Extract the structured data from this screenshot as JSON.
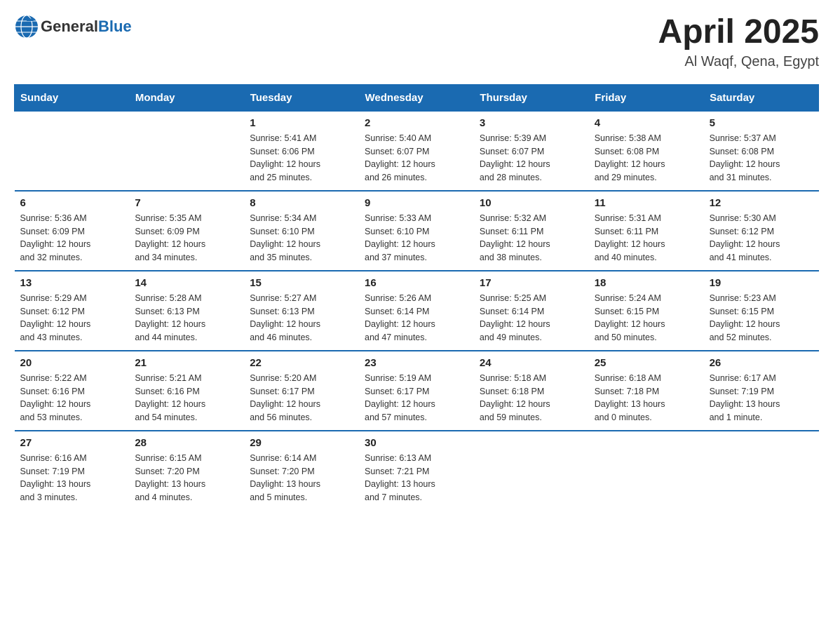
{
  "header": {
    "logo_general": "General",
    "logo_blue": "Blue",
    "month_year": "April 2025",
    "location": "Al Waqf, Qena, Egypt"
  },
  "weekdays": [
    "Sunday",
    "Monday",
    "Tuesday",
    "Wednesday",
    "Thursday",
    "Friday",
    "Saturday"
  ],
  "weeks": [
    [
      {
        "day": "",
        "info": ""
      },
      {
        "day": "",
        "info": ""
      },
      {
        "day": "1",
        "info": "Sunrise: 5:41 AM\nSunset: 6:06 PM\nDaylight: 12 hours\nand 25 minutes."
      },
      {
        "day": "2",
        "info": "Sunrise: 5:40 AM\nSunset: 6:07 PM\nDaylight: 12 hours\nand 26 minutes."
      },
      {
        "day": "3",
        "info": "Sunrise: 5:39 AM\nSunset: 6:07 PM\nDaylight: 12 hours\nand 28 minutes."
      },
      {
        "day": "4",
        "info": "Sunrise: 5:38 AM\nSunset: 6:08 PM\nDaylight: 12 hours\nand 29 minutes."
      },
      {
        "day": "5",
        "info": "Sunrise: 5:37 AM\nSunset: 6:08 PM\nDaylight: 12 hours\nand 31 minutes."
      }
    ],
    [
      {
        "day": "6",
        "info": "Sunrise: 5:36 AM\nSunset: 6:09 PM\nDaylight: 12 hours\nand 32 minutes."
      },
      {
        "day": "7",
        "info": "Sunrise: 5:35 AM\nSunset: 6:09 PM\nDaylight: 12 hours\nand 34 minutes."
      },
      {
        "day": "8",
        "info": "Sunrise: 5:34 AM\nSunset: 6:10 PM\nDaylight: 12 hours\nand 35 minutes."
      },
      {
        "day": "9",
        "info": "Sunrise: 5:33 AM\nSunset: 6:10 PM\nDaylight: 12 hours\nand 37 minutes."
      },
      {
        "day": "10",
        "info": "Sunrise: 5:32 AM\nSunset: 6:11 PM\nDaylight: 12 hours\nand 38 minutes."
      },
      {
        "day": "11",
        "info": "Sunrise: 5:31 AM\nSunset: 6:11 PM\nDaylight: 12 hours\nand 40 minutes."
      },
      {
        "day": "12",
        "info": "Sunrise: 5:30 AM\nSunset: 6:12 PM\nDaylight: 12 hours\nand 41 minutes."
      }
    ],
    [
      {
        "day": "13",
        "info": "Sunrise: 5:29 AM\nSunset: 6:12 PM\nDaylight: 12 hours\nand 43 minutes."
      },
      {
        "day": "14",
        "info": "Sunrise: 5:28 AM\nSunset: 6:13 PM\nDaylight: 12 hours\nand 44 minutes."
      },
      {
        "day": "15",
        "info": "Sunrise: 5:27 AM\nSunset: 6:13 PM\nDaylight: 12 hours\nand 46 minutes."
      },
      {
        "day": "16",
        "info": "Sunrise: 5:26 AM\nSunset: 6:14 PM\nDaylight: 12 hours\nand 47 minutes."
      },
      {
        "day": "17",
        "info": "Sunrise: 5:25 AM\nSunset: 6:14 PM\nDaylight: 12 hours\nand 49 minutes."
      },
      {
        "day": "18",
        "info": "Sunrise: 5:24 AM\nSunset: 6:15 PM\nDaylight: 12 hours\nand 50 minutes."
      },
      {
        "day": "19",
        "info": "Sunrise: 5:23 AM\nSunset: 6:15 PM\nDaylight: 12 hours\nand 52 minutes."
      }
    ],
    [
      {
        "day": "20",
        "info": "Sunrise: 5:22 AM\nSunset: 6:16 PM\nDaylight: 12 hours\nand 53 minutes."
      },
      {
        "day": "21",
        "info": "Sunrise: 5:21 AM\nSunset: 6:16 PM\nDaylight: 12 hours\nand 54 minutes."
      },
      {
        "day": "22",
        "info": "Sunrise: 5:20 AM\nSunset: 6:17 PM\nDaylight: 12 hours\nand 56 minutes."
      },
      {
        "day": "23",
        "info": "Sunrise: 5:19 AM\nSunset: 6:17 PM\nDaylight: 12 hours\nand 57 minutes."
      },
      {
        "day": "24",
        "info": "Sunrise: 5:18 AM\nSunset: 6:18 PM\nDaylight: 12 hours\nand 59 minutes."
      },
      {
        "day": "25",
        "info": "Sunrise: 6:18 AM\nSunset: 7:18 PM\nDaylight: 13 hours\nand 0 minutes."
      },
      {
        "day": "26",
        "info": "Sunrise: 6:17 AM\nSunset: 7:19 PM\nDaylight: 13 hours\nand 1 minute."
      }
    ],
    [
      {
        "day": "27",
        "info": "Sunrise: 6:16 AM\nSunset: 7:19 PM\nDaylight: 13 hours\nand 3 minutes."
      },
      {
        "day": "28",
        "info": "Sunrise: 6:15 AM\nSunset: 7:20 PM\nDaylight: 13 hours\nand 4 minutes."
      },
      {
        "day": "29",
        "info": "Sunrise: 6:14 AM\nSunset: 7:20 PM\nDaylight: 13 hours\nand 5 minutes."
      },
      {
        "day": "30",
        "info": "Sunrise: 6:13 AM\nSunset: 7:21 PM\nDaylight: 13 hours\nand 7 minutes."
      },
      {
        "day": "",
        "info": ""
      },
      {
        "day": "",
        "info": ""
      },
      {
        "day": "",
        "info": ""
      }
    ]
  ]
}
